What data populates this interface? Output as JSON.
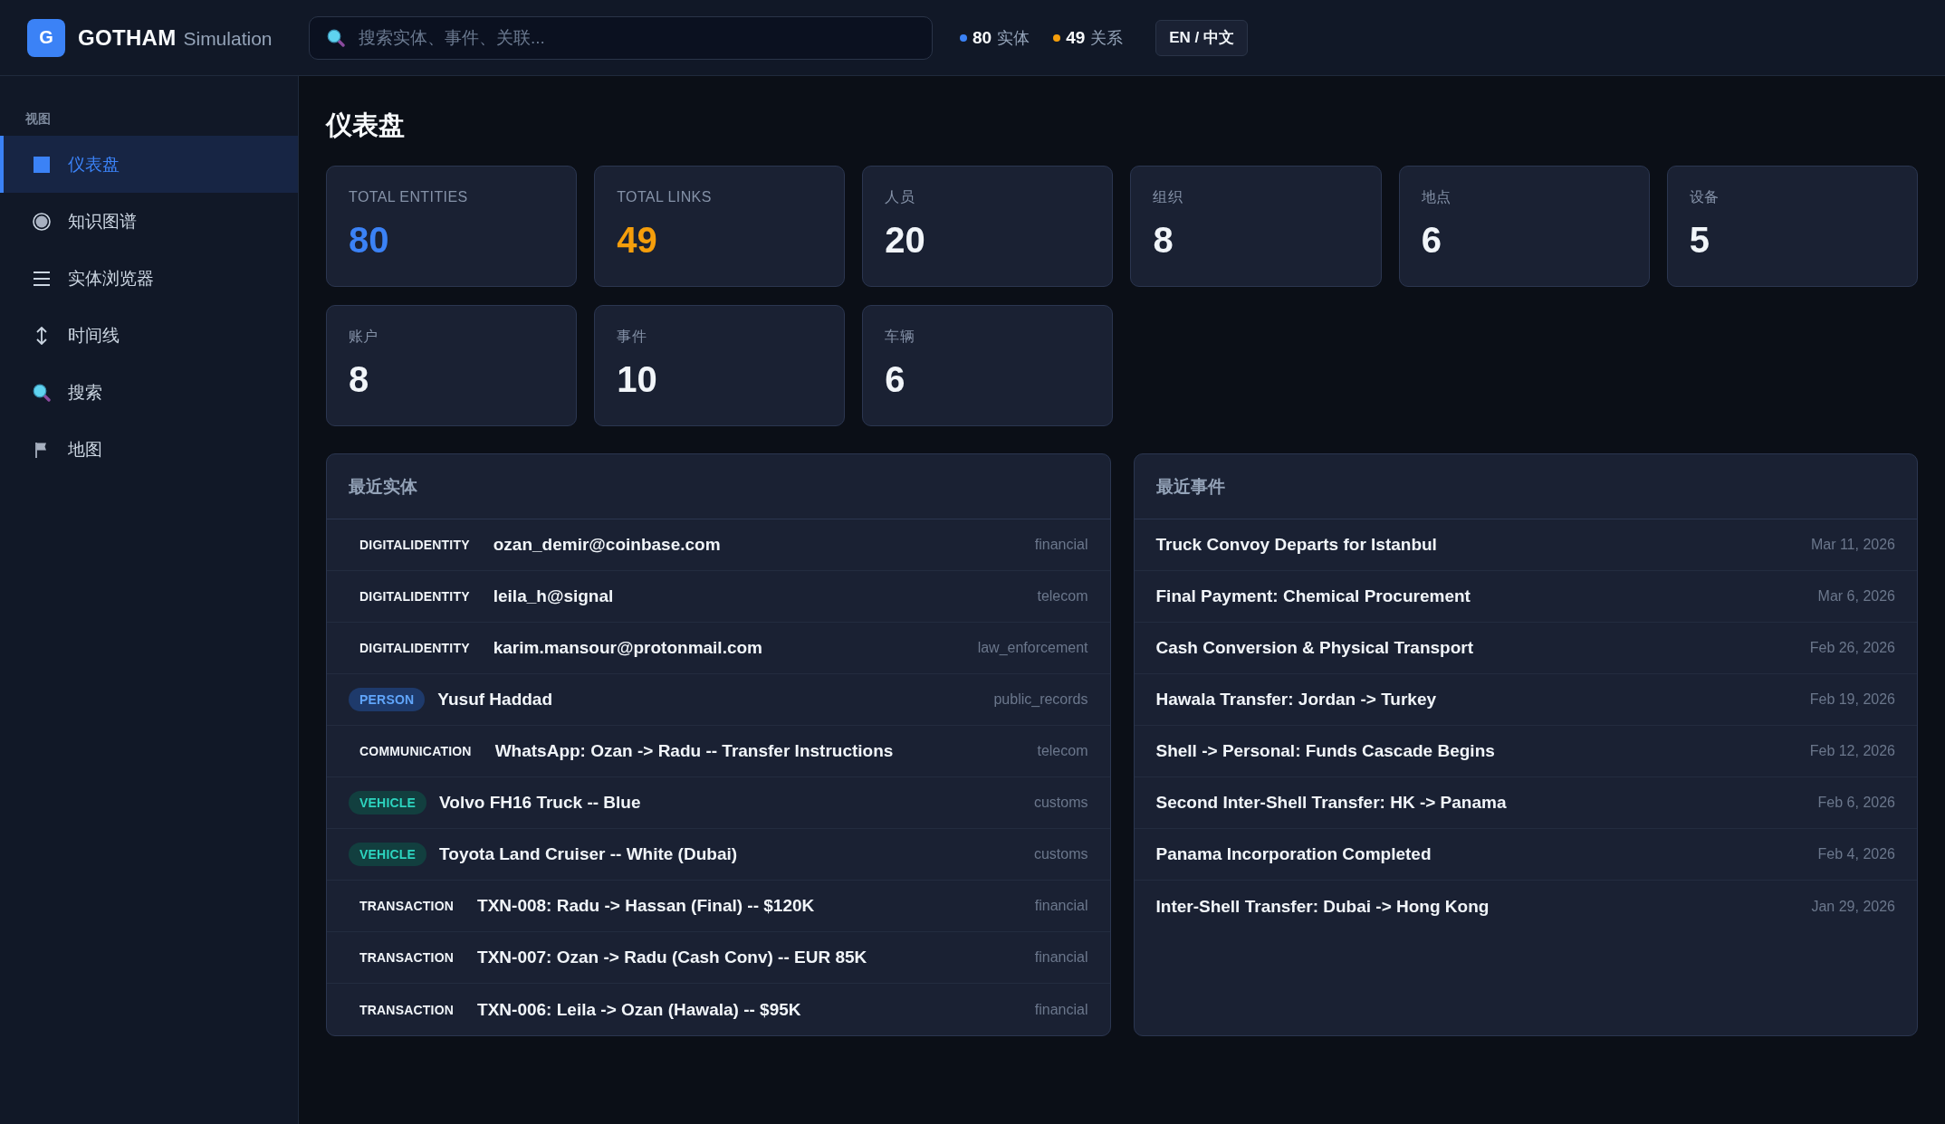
{
  "app": {
    "logo_letter": "G",
    "name": "GOTHAM",
    "subtitle": "Simulation"
  },
  "search": {
    "placeholder": "搜索实体、事件、关联..."
  },
  "counters": [
    {
      "value": "80",
      "label": "实体",
      "color": "#3b82f6"
    },
    {
      "value": "49",
      "label": "关系",
      "color": "#f59e0b"
    }
  ],
  "language_button": "EN / 中文",
  "sidebar": {
    "section": "视图",
    "items": [
      {
        "label": "仪表盘",
        "selected": true
      },
      {
        "label": "知识图谱",
        "selected": false
      },
      {
        "label": "实体浏览器",
        "selected": false
      },
      {
        "label": "时间线",
        "selected": false
      },
      {
        "label": "搜索",
        "selected": false
      },
      {
        "label": "地图",
        "selected": false
      }
    ]
  },
  "page_title": "仪表盘",
  "stats": [
    {
      "label": "TOTAL ENTITIES",
      "value": "80",
      "color": "#3b82f6"
    },
    {
      "label": "TOTAL LINKS",
      "value": "49",
      "color": "#f59e0b"
    },
    {
      "label": "人员",
      "value": "20",
      "color": "#f1f5f9"
    },
    {
      "label": "组织",
      "value": "8",
      "color": "#f1f5f9"
    },
    {
      "label": "地点",
      "value": "6",
      "color": "#f1f5f9"
    },
    {
      "label": "设备",
      "value": "5",
      "color": "#f1f5f9"
    },
    {
      "label": "账户",
      "value": "8",
      "color": "#f1f5f9"
    },
    {
      "label": "事件",
      "value": "10",
      "color": "#f1f5f9"
    },
    {
      "label": "车辆",
      "value": "6",
      "color": "#f1f5f9"
    }
  ],
  "recent_entities": {
    "title": "最近实体",
    "rows": [
      {
        "type": "DIGITALIDENTITY",
        "kind": "plain",
        "name": "ozan_demir@coinbase.com",
        "source": "financial"
      },
      {
        "type": "DIGITALIDENTITY",
        "kind": "plain",
        "name": "leila_h@signal",
        "source": "telecom"
      },
      {
        "type": "DIGITALIDENTITY",
        "kind": "plain",
        "name": "karim.mansour@protonmail.com",
        "source": "law_enforcement"
      },
      {
        "type": "PERSON",
        "kind": "person",
        "name": "Yusuf Haddad",
        "source": "public_records"
      },
      {
        "type": "COMMUNICATION",
        "kind": "plain",
        "name": "WhatsApp: Ozan -> Radu -- Transfer Instructions",
        "source": "telecom"
      },
      {
        "type": "VEHICLE",
        "kind": "vehicle",
        "name": "Volvo FH16 Truck -- Blue",
        "source": "customs"
      },
      {
        "type": "VEHICLE",
        "kind": "vehicle",
        "name": "Toyota Land Cruiser -- White (Dubai)",
        "source": "customs"
      },
      {
        "type": "TRANSACTION",
        "kind": "plain",
        "name": "TXN-008: Radu -> Hassan (Final) -- $120K",
        "source": "financial"
      },
      {
        "type": "TRANSACTION",
        "kind": "plain",
        "name": "TXN-007: Ozan -> Radu (Cash Conv) -- EUR 85K",
        "source": "financial"
      },
      {
        "type": "TRANSACTION",
        "kind": "plain",
        "name": "TXN-006: Leila -> Ozan (Hawala) -- $95K",
        "source": "financial"
      }
    ]
  },
  "recent_events": {
    "title": "最近事件",
    "rows": [
      {
        "title": "Truck Convoy Departs for Istanbul",
        "date": "Mar 11, 2026"
      },
      {
        "title": "Final Payment: Chemical Procurement",
        "date": "Mar 6, 2026"
      },
      {
        "title": "Cash Conversion & Physical Transport",
        "date": "Feb 26, 2026"
      },
      {
        "title": "Hawala Transfer: Jordan -> Turkey",
        "date": "Feb 19, 2026"
      },
      {
        "title": "Shell -> Personal: Funds Cascade Begins",
        "date": "Feb 12, 2026"
      },
      {
        "title": "Second Inter-Shell Transfer: HK -> Panama",
        "date": "Feb 6, 2026"
      },
      {
        "title": "Panama Incorporation Completed",
        "date": "Feb 4, 2026"
      },
      {
        "title": "Inter-Shell Transfer: Dubai -> Hong Kong",
        "date": "Jan 29, 2026"
      }
    ]
  }
}
